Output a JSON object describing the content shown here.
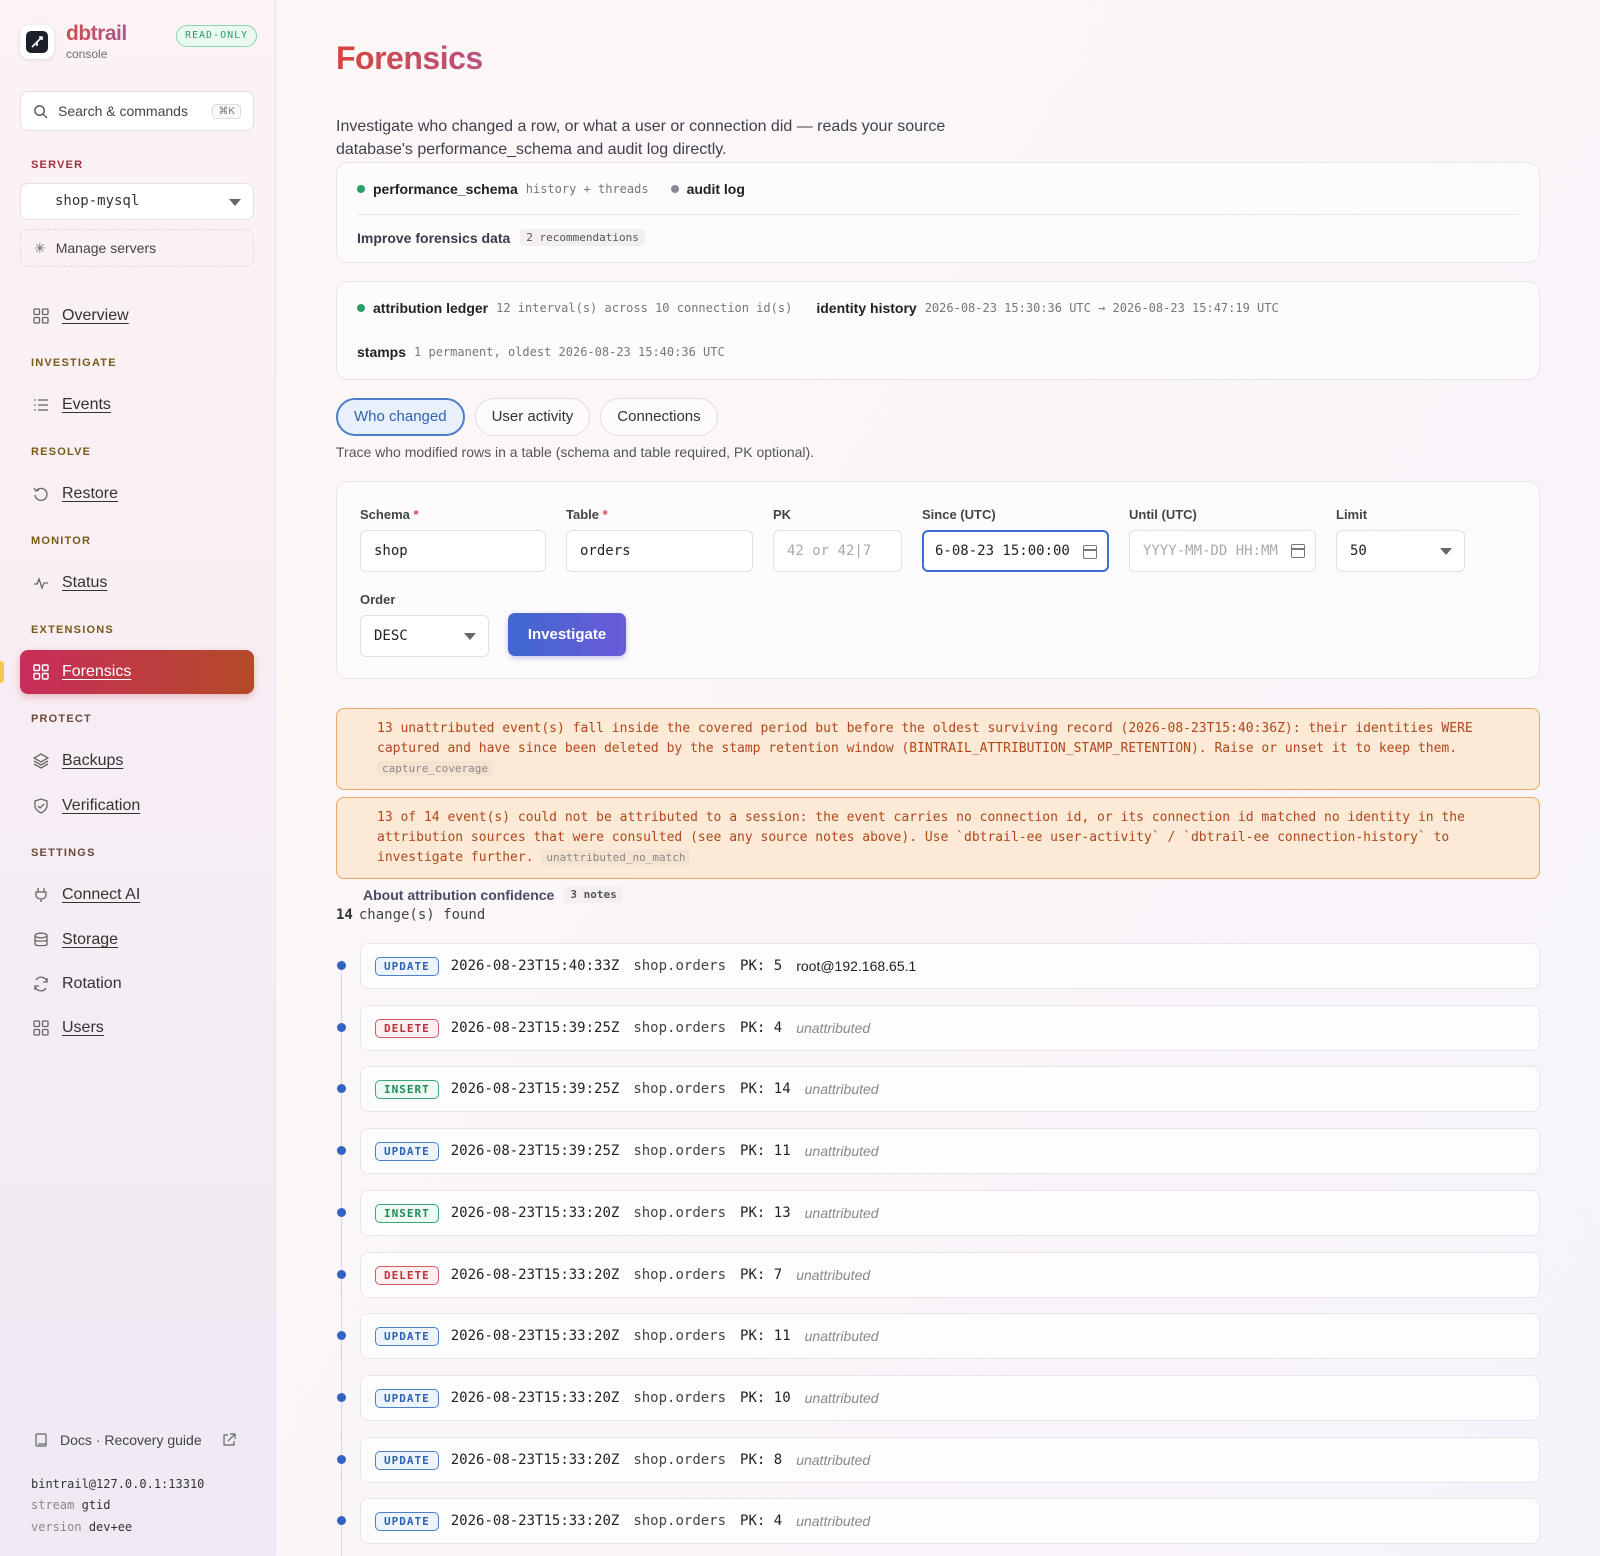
{
  "brand": {
    "name": "dbtrail",
    "sub": "console",
    "badge": "READ-ONLY"
  },
  "search": {
    "label": "Search & commands",
    "kbd": "⌘K"
  },
  "sidebar": {
    "server_label": "SERVER",
    "server_value": "shop-mysql",
    "manage": "Manage servers",
    "overview": "Overview",
    "investigate_label": "INVESTIGATE",
    "events": "Events",
    "resolve_label": "RESOLVE",
    "restore": "Restore",
    "monitor_label": "MONITOR",
    "status": "Status",
    "extensions_label": "EXTENSIONS",
    "forensics": "Forensics",
    "protect_label": "PROTECT",
    "backups": "Backups",
    "verification": "Verification",
    "settings_label": "SETTINGS",
    "connect_ai": "Connect AI",
    "storage": "Storage",
    "rotation": "Rotation",
    "users": "Users",
    "docs": "Docs · Recovery guide",
    "conn": "bintrail@127.0.0.1:13310",
    "stream_label": "stream",
    "stream_value": "gtid",
    "version_label": "version",
    "version_value": "dev+ee"
  },
  "page": {
    "title": "Forensics",
    "description": "Investigate who changed a row, or what a user or connection did — reads your source database's performance_schema and audit log directly."
  },
  "sources": {
    "ps_name": "performance_schema",
    "ps_detail": "history + threads",
    "audit_name": "audit log",
    "improve": "Improve forensics data",
    "improve_count": "2 recommendations"
  },
  "attribution": {
    "ledger_name": "attribution ledger",
    "ledger_detail": "12 interval(s) across 10 connection id(s)",
    "identity_name": "identity history",
    "identity_detail": "2026-08-23 15:30:36 UTC → 2026-08-23 15:47:19 UTC",
    "stamps_name": "stamps",
    "stamps_detail": "1 permanent, oldest 2026-08-23 15:40:36 UTC"
  },
  "tabs": [
    "Who changed",
    "User activity",
    "Connections"
  ],
  "hint": "Trace who modified rows in a table (schema and table required, PK optional).",
  "form": {
    "schema_label": "Schema",
    "schema_value": "shop",
    "table_label": "Table",
    "table_value": "orders",
    "pk_label": "PK",
    "pk_placeholder": "42 or 42|7",
    "since_label": "Since (UTC)",
    "since_value": "6-08-23 15:00:00",
    "until_label": "Until (UTC)",
    "until_placeholder": "YYYY-MM-DD HH:MM",
    "limit_label": "Limit",
    "limit_value": "50",
    "order_label": "Order",
    "order_value": "DESC",
    "submit": "Investigate"
  },
  "warnings": [
    {
      "text": "13 unattributed event(s) fall inside the covered period but before the oldest surviving record (2026-08-23T15:40:36Z): their identities WERE captured and have since been deleted by the stamp retention window (BINTRAIL_ATTRIBUTION_STAMP_RETENTION). Raise or unset it to keep them.",
      "code": "capture_coverage"
    },
    {
      "text": "13 of 14 event(s) could not be attributed to a session: the event carries no connection id, or its connection id matched no identity in the attribution sources that were consulted (see any source notes above). Use `dbtrail-ee user-activity` / `dbtrail-ee connection-history` to investigate further.",
      "code": "unattributed_no_match"
    }
  ],
  "about": {
    "label": "About attribution confidence",
    "notes": "3 notes"
  },
  "result": {
    "count": "14",
    "suffix": "change(s) found"
  },
  "rows": [
    {
      "op": "UPDATE",
      "ts": "2026-08-23T15:40:33Z",
      "tbl": "shop.orders",
      "pk": "PK: 5",
      "who": "root@192.168.65.1"
    },
    {
      "op": "DELETE",
      "ts": "2026-08-23T15:39:25Z",
      "tbl": "shop.orders",
      "pk": "PK: 4",
      "who": "unattributed"
    },
    {
      "op": "INSERT",
      "ts": "2026-08-23T15:39:25Z",
      "tbl": "shop.orders",
      "pk": "PK: 14",
      "who": "unattributed"
    },
    {
      "op": "UPDATE",
      "ts": "2026-08-23T15:39:25Z",
      "tbl": "shop.orders",
      "pk": "PK: 11",
      "who": "unattributed"
    },
    {
      "op": "INSERT",
      "ts": "2026-08-23T15:33:20Z",
      "tbl": "shop.orders",
      "pk": "PK: 13",
      "who": "unattributed"
    },
    {
      "op": "DELETE",
      "ts": "2026-08-23T15:33:20Z",
      "tbl": "shop.orders",
      "pk": "PK: 7",
      "who": "unattributed"
    },
    {
      "op": "UPDATE",
      "ts": "2026-08-23T15:33:20Z",
      "tbl": "shop.orders",
      "pk": "PK: 11",
      "who": "unattributed"
    },
    {
      "op": "UPDATE",
      "ts": "2026-08-23T15:33:20Z",
      "tbl": "shop.orders",
      "pk": "PK: 10",
      "who": "unattributed"
    },
    {
      "op": "UPDATE",
      "ts": "2026-08-23T15:33:20Z",
      "tbl": "shop.orders",
      "pk": "PK: 8",
      "who": "unattributed"
    },
    {
      "op": "UPDATE",
      "ts": "2026-08-23T15:33:20Z",
      "tbl": "shop.orders",
      "pk": "PK: 4",
      "who": "unattributed"
    }
  ]
}
